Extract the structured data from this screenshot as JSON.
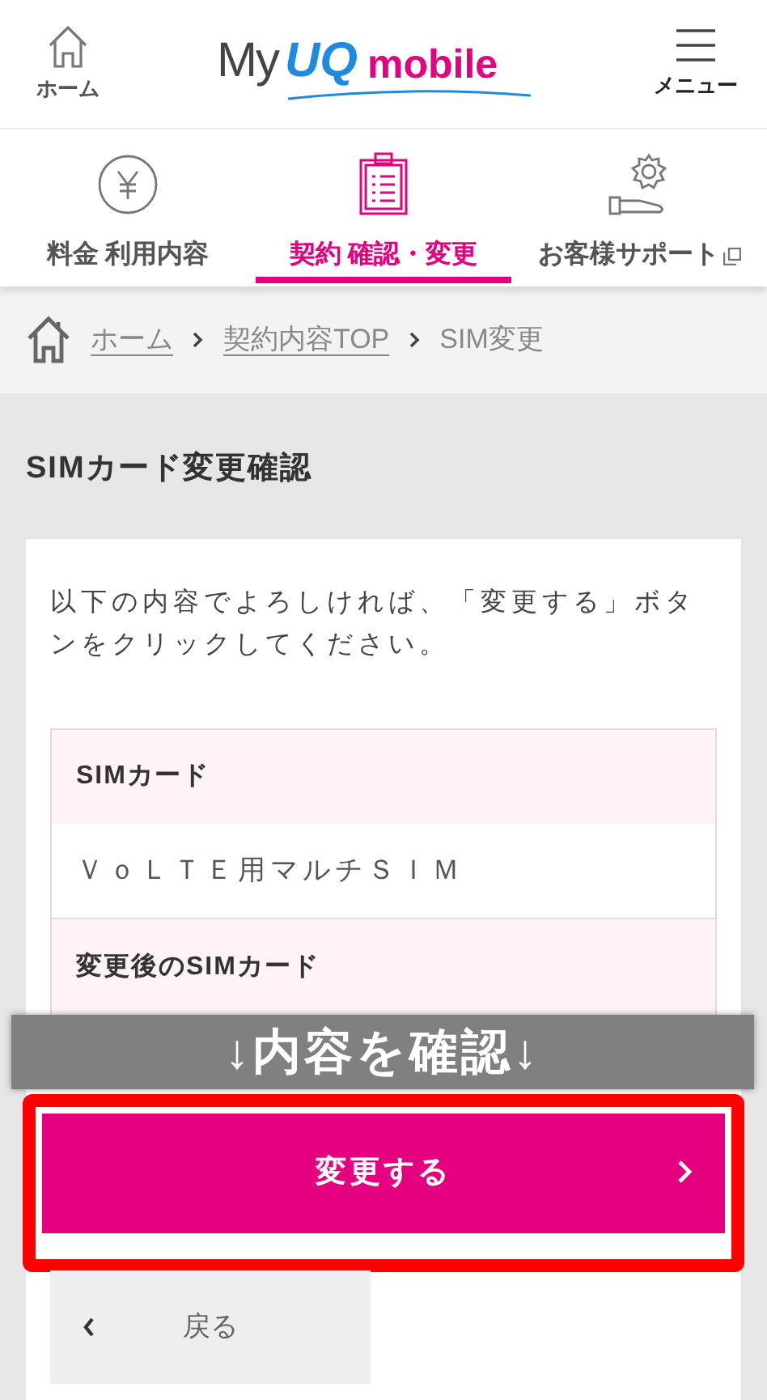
{
  "header": {
    "home_label": "ホーム",
    "logo": {
      "my": "My",
      "uq": "UQ",
      "mobile": "mobile"
    },
    "menu_label": "メニュー"
  },
  "tabs": [
    {
      "label": "料金 利用内容",
      "selected": false,
      "kind": "yen"
    },
    {
      "label": "契約 確認・変更",
      "selected": true,
      "kind": "clipboard"
    },
    {
      "label": "お客様サポート",
      "selected": false,
      "kind": "support",
      "external": true
    }
  ],
  "breadcrumb": [
    {
      "label": "ホーム",
      "link": true
    },
    {
      "label": "契約内容TOP",
      "link": true
    },
    {
      "label": "SIM変更",
      "link": false
    }
  ],
  "page_title": "SIMカード変更確認",
  "intro": "以下の内容でよろしければ、「変更する」ボタンをクリックしてください。",
  "table": [
    {
      "heading": "SIMカード",
      "value": "ＶｏＬＴＥ用マルチＳＩＭ"
    },
    {
      "heading": "変更後のSIMカード"
    }
  ],
  "overlay_caption": "↓内容を確認↓",
  "submit_button": "変更する",
  "back_button": "戻る"
}
